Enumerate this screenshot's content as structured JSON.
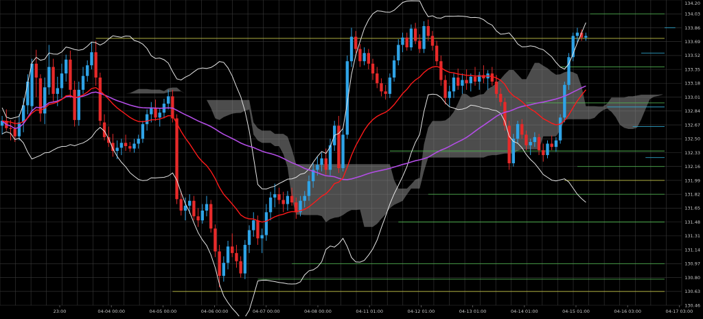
{
  "chart_data": {
    "type": "candlestick",
    "background": "#000000",
    "grid": true,
    "gridColor": "#3a3a3a",
    "ylim": [
      130.46,
      134.2
    ],
    "y_ticks": [
      134.2,
      134.03,
      133.86,
      133.69,
      133.52,
      133.35,
      133.18,
      133.01,
      132.84,
      132.67,
      132.5,
      132.33,
      132.16,
      131.99,
      131.82,
      131.65,
      131.48,
      131.31,
      131.14,
      130.97,
      130.8,
      130.63,
      130.46
    ],
    "y_tick_labels": [
      "134.20",
      "134.03",
      "133.86",
      "133.69",
      "133.52",
      "133.35",
      "133.18",
      "133.01",
      "132.84",
      "132.67",
      "132.50",
      "132.33",
      "132.16",
      "131.99",
      "131.82",
      "131.65",
      "131.48",
      "131.31",
      "131.14",
      "130.97",
      "130.80",
      "130.63",
      "130.46"
    ],
    "x_tick_labels": [
      "23:00",
      "04-04 00:00",
      "04-05 00:00",
      "04-06 00:00",
      "04-07 00:00",
      "04-08 00:00",
      "04-11 01:00",
      "04-12 01:00",
      "04-13 01:00",
      "04-14 01:00",
      "04-15 01:00",
      "04-16 03:00",
      "04-17 03:00"
    ],
    "x_tick_index": [
      14,
      28,
      42,
      56,
      70,
      84,
      98,
      112,
      126,
      140,
      154,
      168,
      182
    ],
    "bars": 160,
    "candles": [
      [
        132.66,
        132.78,
        132.55,
        132.72
      ],
      [
        132.72,
        132.86,
        132.6,
        132.63
      ],
      [
        132.63,
        132.73,
        132.48,
        132.62
      ],
      [
        132.62,
        132.73,
        132.46,
        132.53
      ],
      [
        132.53,
        132.8,
        132.48,
        132.7
      ],
      [
        132.7,
        133.0,
        132.58,
        132.91
      ],
      [
        132.91,
        133.29,
        132.8,
        133.2
      ],
      [
        132.9,
        133.48,
        132.83,
        133.42
      ],
      [
        133.42,
        133.59,
        133.01,
        133.25
      ],
      [
        133.24,
        133.29,
        132.71,
        132.81
      ],
      [
        132.81,
        133.25,
        132.68,
        133.13
      ],
      [
        133.13,
        133.65,
        133.04,
        133.38
      ],
      [
        133.38,
        133.48,
        132.95,
        133.05
      ],
      [
        133.05,
        133.26,
        132.9,
        133.12
      ],
      [
        133.12,
        133.42,
        133.0,
        133.3
      ],
      [
        133.3,
        133.53,
        133.2,
        133.47
      ],
      [
        133.47,
        133.58,
        133.0,
        133.1
      ],
      [
        133.1,
        133.21,
        132.65,
        132.73
      ],
      [
        132.73,
        133.2,
        132.66,
        133.1
      ],
      [
        133.1,
        133.38,
        133.05,
        133.27
      ],
      [
        133.27,
        133.46,
        133.2,
        133.4
      ],
      [
        133.4,
        133.68,
        133.35,
        133.56
      ],
      [
        133.56,
        133.7,
        133.15,
        133.25
      ],
      [
        133.25,
        133.31,
        132.66,
        132.72
      ],
      [
        132.7,
        132.8,
        132.48,
        132.52
      ],
      [
        132.52,
        132.65,
        132.4,
        132.45
      ],
      [
        132.45,
        132.56,
        132.28,
        132.35
      ],
      [
        132.35,
        132.48,
        132.25,
        132.39
      ],
      [
        132.39,
        132.5,
        132.3,
        132.45
      ],
      [
        132.45,
        132.55,
        132.35,
        132.41
      ],
      [
        132.41,
        132.46,
        132.34,
        132.38
      ],
      [
        132.38,
        132.5,
        132.33,
        132.44
      ],
      [
        132.44,
        132.55,
        132.38,
        132.5
      ],
      [
        132.5,
        132.72,
        132.45,
        132.68
      ],
      [
        132.68,
        132.86,
        132.6,
        132.8
      ],
      [
        132.8,
        132.95,
        132.7,
        132.88
      ],
      [
        132.88,
        132.98,
        132.72,
        132.76
      ],
      [
        132.76,
        132.88,
        132.65,
        132.82
      ],
      [
        132.82,
        132.99,
        132.75,
        132.93
      ],
      [
        132.93,
        133.1,
        132.86,
        133.02
      ],
      [
        133.02,
        133.1,
        132.7,
        132.75
      ],
      [
        132.75,
        132.8,
        131.7,
        131.76
      ],
      [
        131.76,
        131.86,
        131.56,
        131.62
      ],
      [
        131.62,
        131.78,
        131.5,
        131.68
      ],
      [
        131.68,
        131.82,
        131.58,
        131.74
      ],
      [
        131.74,
        131.8,
        131.5,
        131.55
      ],
      [
        131.55,
        131.65,
        131.42,
        131.5
      ],
      [
        131.5,
        131.7,
        131.46,
        131.62
      ],
      [
        131.62,
        131.8,
        131.55,
        131.7
      ],
      [
        131.7,
        131.75,
        131.35,
        131.4
      ],
      [
        131.4,
        131.45,
        131.05,
        131.12
      ],
      [
        131.12,
        131.2,
        130.68,
        130.82
      ],
      [
        130.82,
        131.06,
        130.75,
        130.98
      ],
      [
        130.98,
        131.25,
        130.9,
        131.18
      ],
      [
        131.18,
        131.34,
        131.05,
        131.1
      ],
      [
        131.1,
        131.2,
        130.92,
        131.0
      ],
      [
        131.0,
        131.06,
        130.8,
        130.85
      ],
      [
        130.85,
        131.26,
        130.78,
        131.2
      ],
      [
        131.2,
        131.44,
        131.1,
        131.38
      ],
      [
        131.38,
        131.6,
        131.3,
        131.5
      ],
      [
        131.5,
        131.56,
        131.2,
        131.28
      ],
      [
        131.28,
        131.4,
        131.1,
        131.32
      ],
      [
        131.32,
        131.7,
        131.25,
        131.6
      ],
      [
        131.6,
        131.85,
        131.5,
        131.78
      ],
      [
        131.78,
        131.95,
        131.66,
        131.82
      ],
      [
        131.82,
        131.9,
        131.7,
        131.75
      ],
      [
        131.75,
        131.85,
        131.6,
        131.7
      ],
      [
        131.7,
        131.86,
        131.62,
        131.8
      ],
      [
        131.8,
        131.9,
        131.68,
        131.72
      ],
      [
        131.72,
        131.78,
        131.52,
        131.6
      ],
      [
        131.6,
        131.8,
        131.55,
        131.74
      ],
      [
        131.74,
        131.86,
        131.66,
        131.8
      ],
      [
        131.8,
        132.05,
        131.74,
        131.98
      ],
      [
        131.98,
        132.2,
        131.9,
        132.12
      ],
      [
        132.12,
        132.28,
        132.05,
        132.18
      ],
      [
        132.18,
        132.33,
        132.1,
        132.26
      ],
      [
        132.26,
        132.38,
        132.06,
        132.12
      ],
      [
        132.12,
        132.5,
        132.05,
        132.42
      ],
      [
        132.42,
        132.72,
        132.35,
        132.66
      ],
      [
        132.66,
        132.78,
        132.08,
        132.14
      ],
      [
        132.14,
        132.62,
        132.1,
        132.55
      ],
      [
        132.55,
        133.52,
        132.5,
        133.45
      ],
      [
        133.45,
        133.86,
        133.38,
        133.75
      ],
      [
        133.75,
        133.82,
        133.55,
        133.6
      ],
      [
        133.6,
        133.66,
        133.38,
        133.45
      ],
      [
        133.45,
        133.62,
        133.4,
        133.55
      ],
      [
        133.55,
        133.6,
        133.35,
        133.42
      ],
      [
        133.42,
        133.48,
        133.22,
        133.3
      ],
      [
        133.3,
        133.38,
        133.12,
        133.18
      ],
      [
        133.18,
        133.24,
        133.02,
        133.08
      ],
      [
        133.08,
        133.16,
        132.98,
        133.05
      ],
      [
        133.05,
        133.3,
        133.0,
        133.25
      ],
      [
        133.25,
        133.52,
        133.2,
        133.46
      ],
      [
        133.46,
        133.72,
        133.4,
        133.65
      ],
      [
        133.65,
        133.8,
        133.56,
        133.74
      ],
      [
        133.74,
        133.8,
        133.58,
        133.62
      ],
      [
        133.62,
        133.9,
        133.58,
        133.85
      ],
      [
        133.85,
        133.92,
        133.66,
        133.7
      ],
      [
        133.7,
        133.78,
        133.55,
        133.6
      ],
      [
        133.6,
        133.94,
        133.55,
        133.88
      ],
      [
        133.88,
        133.96,
        133.7,
        133.76
      ],
      [
        133.76,
        133.82,
        133.58,
        133.64
      ],
      [
        133.64,
        133.7,
        133.4,
        133.45
      ],
      [
        133.45,
        133.52,
        133.15,
        133.22
      ],
      [
        133.22,
        133.28,
        132.92,
        133.0
      ],
      [
        133.0,
        133.15,
        132.9,
        133.08
      ],
      [
        133.08,
        133.3,
        133.0,
        133.25
      ],
      [
        133.25,
        133.36,
        133.1,
        133.15
      ],
      [
        133.15,
        133.3,
        133.05,
        133.22
      ],
      [
        133.22,
        133.35,
        133.1,
        133.18
      ],
      [
        133.18,
        133.3,
        133.08,
        133.26
      ],
      [
        133.26,
        133.38,
        133.15,
        133.2
      ],
      [
        133.2,
        133.32,
        133.1,
        133.28
      ],
      [
        133.28,
        133.4,
        133.18,
        133.24
      ],
      [
        133.24,
        133.34,
        133.1,
        133.3
      ],
      [
        133.3,
        133.38,
        133.15,
        133.2
      ],
      [
        133.2,
        133.28,
        133.0,
        133.05
      ],
      [
        133.05,
        133.12,
        132.9,
        132.95
      ],
      [
        132.95,
        133.0,
        132.6,
        132.66
      ],
      [
        132.66,
        132.72,
        132.12,
        132.2
      ],
      [
        132.2,
        132.56,
        132.16,
        132.5
      ],
      [
        132.5,
        132.72,
        132.44,
        132.68
      ],
      [
        132.68,
        132.74,
        132.5,
        132.55
      ],
      [
        132.55,
        132.6,
        132.36,
        132.42
      ],
      [
        132.42,
        132.5,
        132.3,
        132.46
      ],
      [
        132.46,
        132.58,
        132.4,
        132.52
      ],
      [
        132.52,
        132.56,
        132.3,
        132.36
      ],
      [
        132.36,
        132.44,
        132.22,
        132.3
      ],
      [
        132.3,
        132.48,
        132.26,
        132.44
      ],
      [
        132.44,
        132.54,
        132.36,
        132.4
      ],
      [
        132.4,
        132.52,
        132.34,
        132.48
      ],
      [
        132.48,
        132.8,
        132.44,
        132.76
      ],
      [
        132.76,
        133.2,
        132.7,
        133.16
      ],
      [
        133.16,
        133.55,
        133.1,
        133.5
      ],
      [
        133.5,
        133.8,
        133.45,
        133.76
      ],
      [
        133.76,
        133.86,
        133.68,
        133.8
      ],
      [
        133.8,
        133.84,
        133.7,
        133.74
      ],
      [
        133.74,
        133.8,
        133.7,
        133.76
      ]
    ],
    "h_levels": [
      {
        "y": 134.03,
        "x0": 138,
        "color": "#4fb04f"
      },
      {
        "y": 133.86,
        "x0": 158,
        "color": "#2fa3c8"
      },
      {
        "y": 133.73,
        "x0": 22,
        "color": "#c8c84a"
      },
      {
        "y": 133.55,
        "x0": 150,
        "color": "#2fa3c8"
      },
      {
        "y": 133.38,
        "x0": 131,
        "color": "#4fb04f"
      },
      {
        "y": 132.94,
        "x0": 123,
        "color": "#4fb04f"
      },
      {
        "y": 132.89,
        "x0": 142,
        "color": "#2fa3c8"
      },
      {
        "y": 132.65,
        "x0": 148,
        "color": "#2fa3c8"
      },
      {
        "y": 132.35,
        "x0": 91,
        "color": "#4fb04f"
      },
      {
        "y": 132.27,
        "x0": 151,
        "color": "#2fa3c8"
      },
      {
        "y": 132.16,
        "x0": 135,
        "color": "#4fb04f"
      },
      {
        "y": 131.99,
        "x0": 132,
        "color": "#c8c84a"
      },
      {
        "y": 131.82,
        "x0": 100,
        "color": "#4fb04f"
      },
      {
        "y": 131.48,
        "x0": 93,
        "color": "#4fb04f"
      },
      {
        "y": 130.97,
        "x0": 68,
        "color": "#4fb04f"
      },
      {
        "y": 130.78,
        "x0": 60,
        "color": "#4fb04f"
      },
      {
        "y": 130.63,
        "x0": 40,
        "color": "#c8c84a"
      }
    ],
    "colors": {
      "up": "#2fa3e6",
      "down": "#e62a2a",
      "ema": "#ff1a1a",
      "sma": "#b34de6",
      "bands": "#e6e6e6",
      "cloud": "#8a8a8a",
      "axis_text": "#c8c8c8"
    }
  }
}
